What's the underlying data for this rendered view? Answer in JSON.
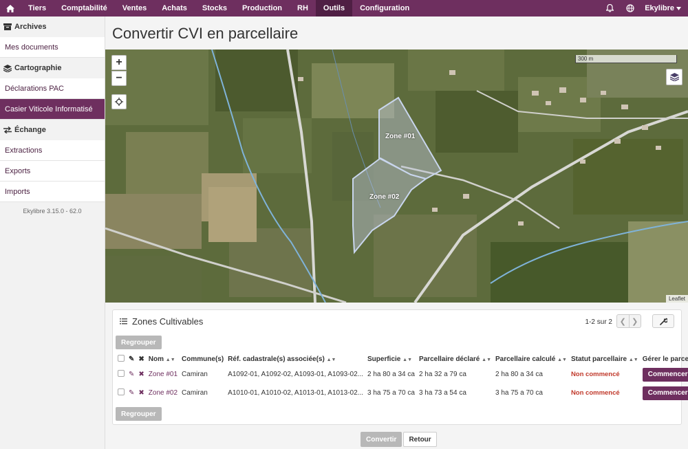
{
  "topnav": {
    "items": [
      {
        "label": "Tiers"
      },
      {
        "label": "Comptabilité"
      },
      {
        "label": "Ventes"
      },
      {
        "label": "Achats"
      },
      {
        "label": "Stocks"
      },
      {
        "label": "Production"
      },
      {
        "label": "RH"
      },
      {
        "label": "Outils"
      },
      {
        "label": "Configuration"
      }
    ],
    "active": "Outils",
    "user": "Ekylibre",
    "icons": [
      "home-icon",
      "bell-icon",
      "globe-icon",
      "caret-down-icon"
    ]
  },
  "sidebar": {
    "sections": [
      {
        "title": "Archives",
        "icon": "archive-icon"
      },
      {
        "title": "Cartographie",
        "icon": "layers-icon"
      },
      {
        "title": "Échange",
        "icon": "exchange-icon"
      }
    ],
    "items": [
      {
        "label": "Mes documents"
      },
      {
        "label": "Déclarations PAC"
      },
      {
        "label": "Casier Viticole Informatisé"
      },
      {
        "label": "Extractions"
      },
      {
        "label": "Exports"
      },
      {
        "label": "Imports"
      }
    ],
    "version": "Ekylibre 3.15.0 - 62.0"
  },
  "page": {
    "title": "Convertir CVI en parcellaire"
  },
  "map": {
    "zoom_in": "+",
    "zoom_out": "−",
    "scale_label": "300 m",
    "attribution": "Leaflet",
    "zones": [
      {
        "label": "Zone #01"
      },
      {
        "label": "Zone #02"
      }
    ]
  },
  "panel": {
    "title": "Zones Cultivables",
    "pagination": "1-2 sur 2",
    "group_button": "Regrouper",
    "columns": [
      "Nom",
      "Commune(s)",
      "Réf. cadastrale(s) associée(s)",
      "Superficie",
      "Parcellaire déclaré",
      "Parcellaire calculé",
      "Statut parcellaire",
      "Gérer le parcellaire"
    ],
    "rows": [
      {
        "name": "Zone #01",
        "commune": "Camiran",
        "refs": "A1092-01, A1092-02, A1093-01, A1093-02...",
        "superficie": "2 ha 80 a 34 ca",
        "declare": "2 ha 32 a 79 ca",
        "calcule": "2 ha 80 a 34 ca",
        "statut": "Non commencé",
        "action": "Commencer"
      },
      {
        "name": "Zone #02",
        "commune": "Camiran",
        "refs": "A1010-01, A1010-02, A1013-01, A1013-02...",
        "superficie": "3 ha 75 a 70 ca",
        "declare": "3 ha 73 a 54 ca",
        "calcule": "3 ha 75 a 70 ca",
        "statut": "Non commencé",
        "action": "Commencer"
      }
    ]
  },
  "footer": {
    "convert": "Convertir",
    "back": "Retour"
  },
  "colors": {
    "brand": "#6e2f5f",
    "status_red": "#c0392b"
  }
}
